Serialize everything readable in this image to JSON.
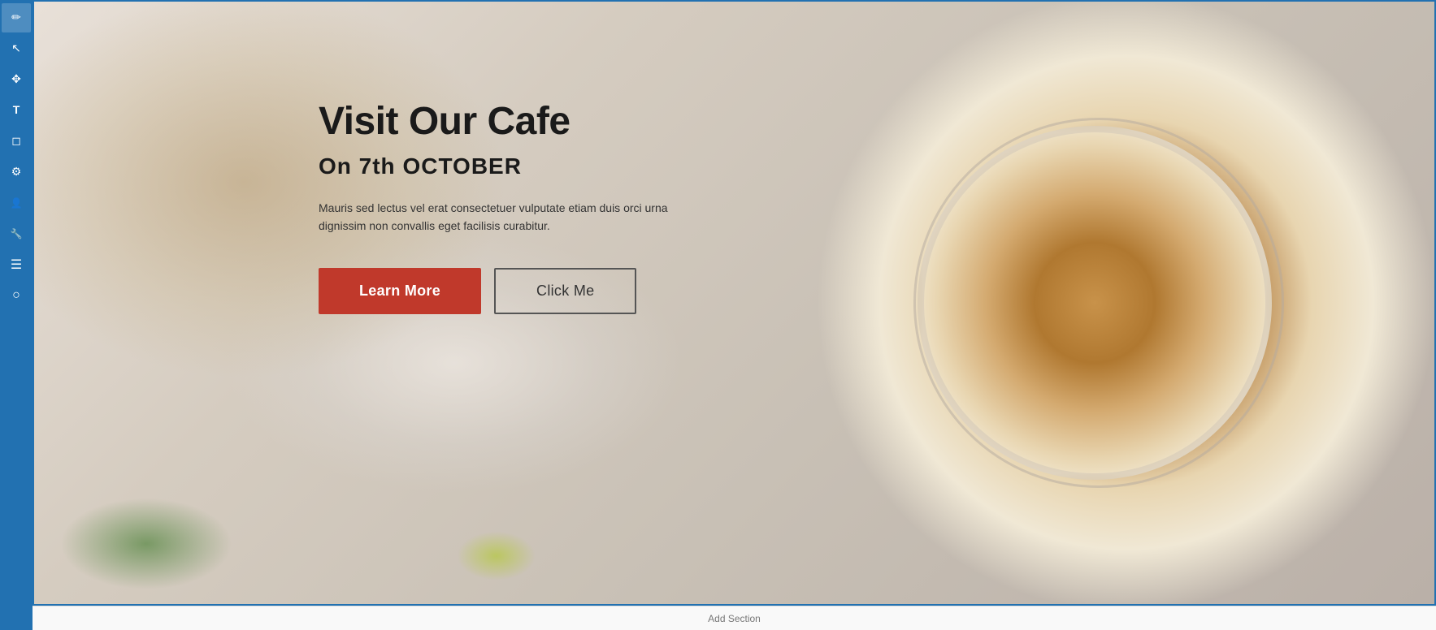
{
  "toolbar": {
    "items": [
      {
        "id": "pencil",
        "icon": "pencil-icon",
        "label": "Edit"
      },
      {
        "id": "arrow",
        "icon": "arrow-icon",
        "label": "Select"
      },
      {
        "id": "move",
        "icon": "move-icon",
        "label": "Move"
      },
      {
        "id": "text",
        "icon": "text-icon",
        "label": "Text"
      },
      {
        "id": "shape",
        "icon": "shape-icon",
        "label": "Shape"
      },
      {
        "id": "settings",
        "icon": "settings-icon",
        "label": "Settings"
      },
      {
        "id": "user",
        "icon": "user-icon",
        "label": "User"
      },
      {
        "id": "tools",
        "icon": "tools-icon",
        "label": "Tools"
      },
      {
        "id": "list",
        "icon": "list-icon",
        "label": "List"
      },
      {
        "id": "circle",
        "icon": "circle-icon",
        "label": "Circle"
      }
    ]
  },
  "hero": {
    "title": "Visit Our Cafe",
    "subtitle": "On 7th OCTOBER",
    "description": "Mauris sed lectus vel erat consectetuer vulputate etiam duis orci urna dignissim non convallis eget facilisis curabitur.",
    "buttons": {
      "learn_more": "Learn More",
      "click_me": "Click Me"
    }
  },
  "bottom": {
    "text": "Add Section"
  },
  "colors": {
    "toolbar_bg": "#2271b1",
    "button_primary_bg": "#c0392b",
    "button_secondary_border": "#555555",
    "title_color": "#1a1a1a",
    "hero_border": "#2271b1"
  }
}
